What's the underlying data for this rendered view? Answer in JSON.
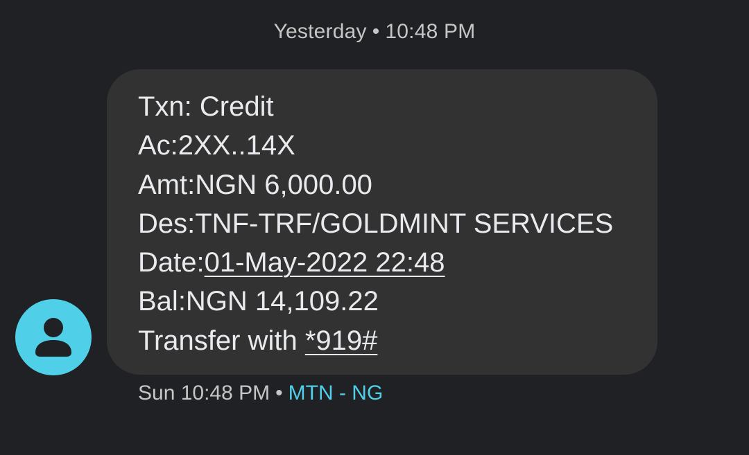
{
  "conversation": {
    "date_divider": {
      "day": "Yesterday",
      "separator": "•",
      "time": "10:48 PM"
    },
    "avatar": {
      "icon": "person-icon",
      "color": "#4fcfe8"
    },
    "message": {
      "lines": {
        "txn": "Txn: Credit",
        "account": "Ac:2XX..14X",
        "amount": "Amt:NGN 6,000.00",
        "description": "Des:TNF-TRF/GOLDMINT SERVICES",
        "date_label": "Date:",
        "date_value": "01-May-2022 22:48",
        "balance": "Bal:NGN 14,109.22",
        "transfer_label": "Transfer with ",
        "transfer_code": "*919#"
      }
    },
    "footer": {
      "time": "Sun 10:48 PM",
      "separator": "•",
      "sim": "MTN - NG"
    }
  },
  "colors": {
    "background": "#202124",
    "bubble": "#323232",
    "accent": "#4fcfe8",
    "text": "#e8eaed",
    "muted_text": "#c4c7c5"
  }
}
